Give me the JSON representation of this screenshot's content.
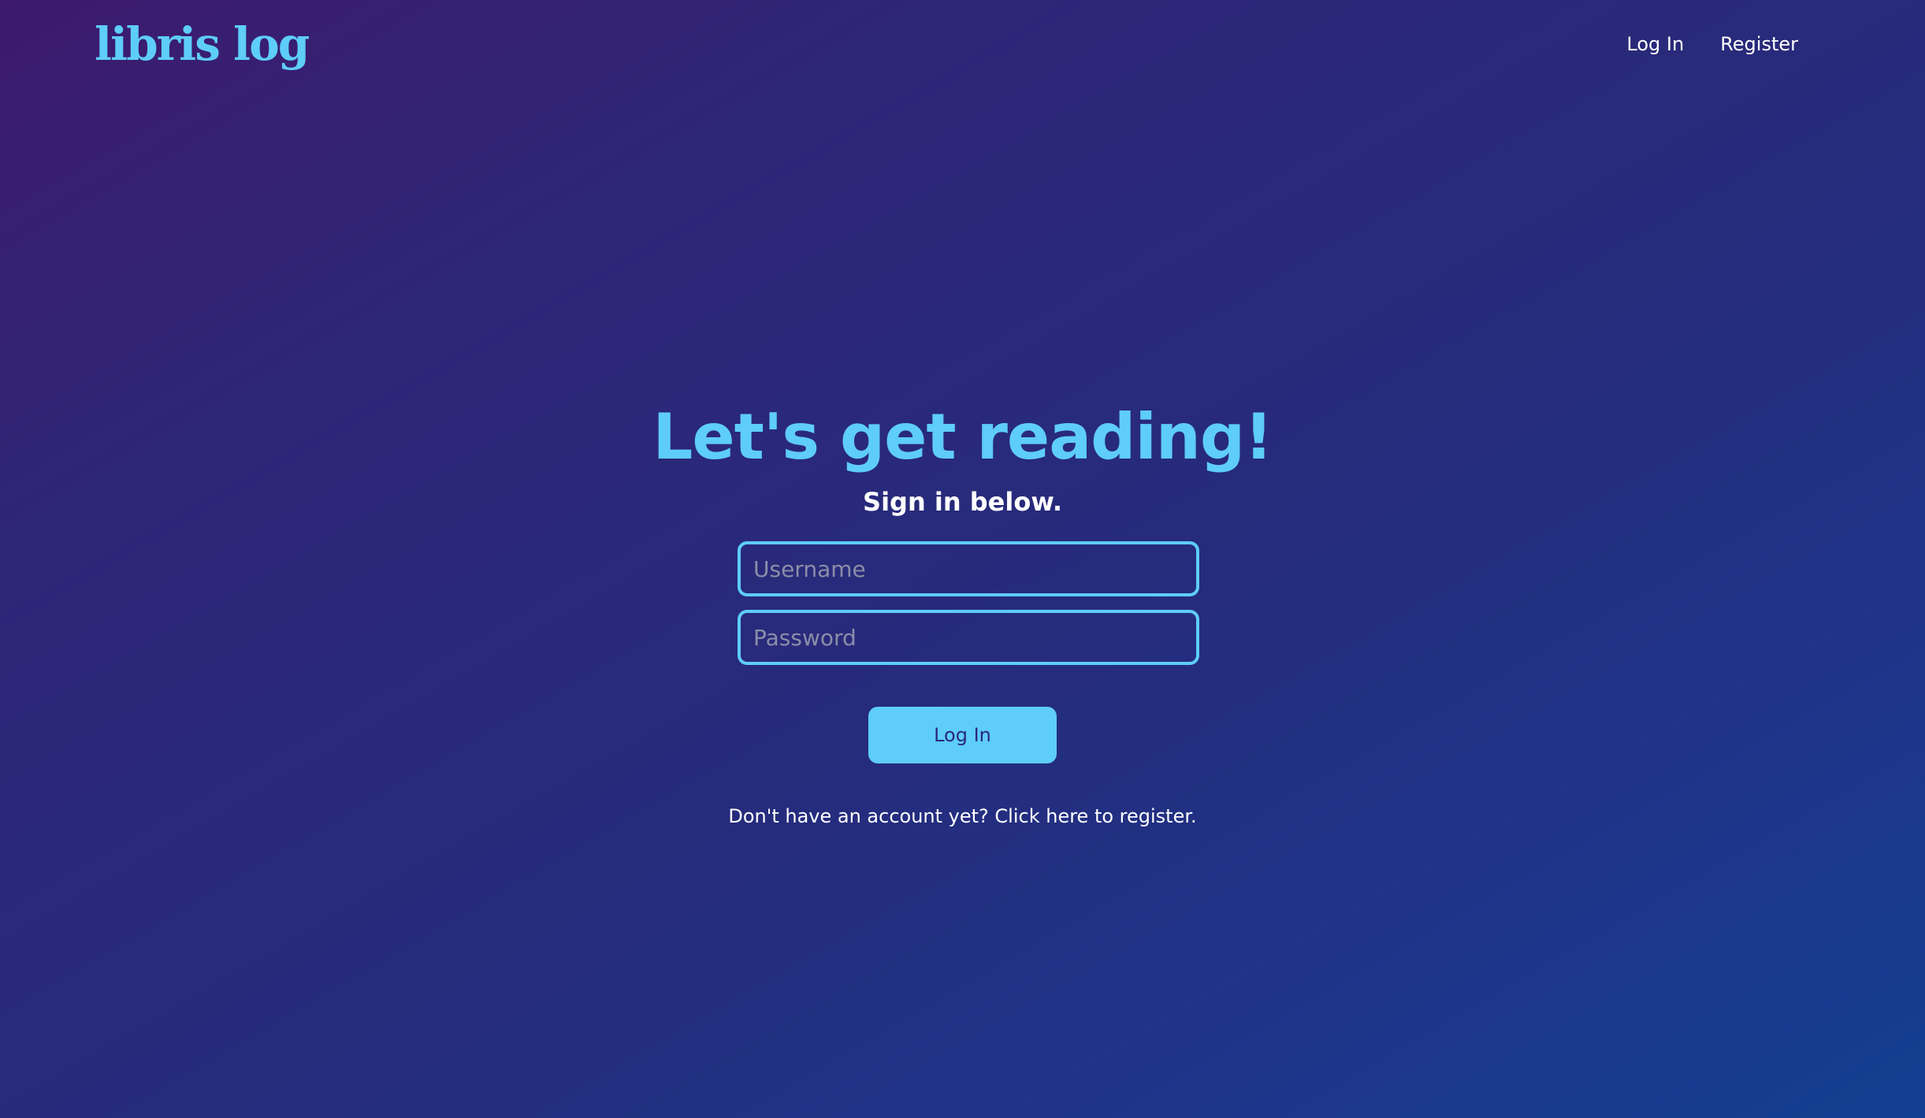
{
  "header": {
    "logo_text": "libris log",
    "nav": {
      "login_label": "Log In",
      "register_label": "Register"
    }
  },
  "main": {
    "headline": "Let's get reading!",
    "subheadline": "Sign in below.",
    "form": {
      "username_placeholder": "Username",
      "username_value": "",
      "password_placeholder": "Password",
      "password_value": "",
      "submit_label": "Log In"
    },
    "register_prompt": "Don't have an account yet?",
    "register_link": "Click here to register."
  },
  "colors": {
    "accent": "#5ecdf8",
    "text": "#ffffff",
    "button_text": "#2b2780",
    "background_start": "#3d1a6e",
    "background_end": "#133f90"
  }
}
